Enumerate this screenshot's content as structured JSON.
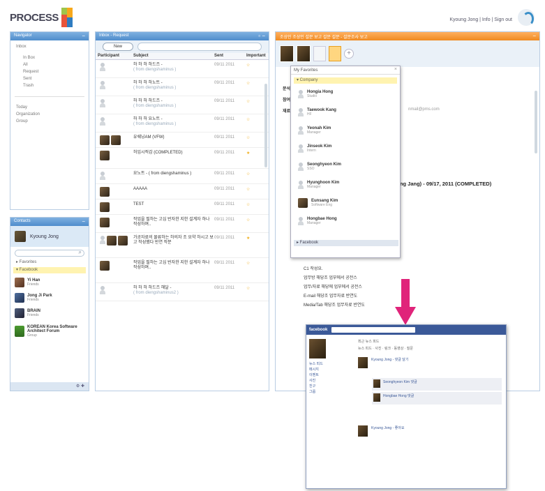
{
  "header": {
    "logo_text": "PROCESS",
    "user_links": "Kyoung Jong | Info | Sign out"
  },
  "nav": {
    "title": "Navigator",
    "top_item": "Inbox",
    "sub_items": [
      "In Box",
      "All",
      "Request",
      "Sent",
      "Trash"
    ],
    "sections": [
      "Today",
      "Organization",
      "Group"
    ]
  },
  "contacts": {
    "title": "Contacts",
    "me_name": "Kyoung Jong",
    "groups": {
      "favorites": "▸ Favorites",
      "facebook": "▾ Facebook"
    },
    "people": [
      {
        "name": "Yi Han",
        "sub": "Friends"
      },
      {
        "name": "Jong Ji Park",
        "sub": "Friends"
      },
      {
        "name": "BRAIN",
        "sub": "Friends"
      },
      {
        "name": "KOREAN Korea Software Architect Forum",
        "sub": "Group"
      }
    ]
  },
  "list": {
    "title": "Inbox - Request",
    "new_button": "New",
    "columns": [
      "Participant",
      "Subject",
      "Sent",
      "Important"
    ],
    "rows": [
      {
        "subject": "하 하 하 하드즈 -",
        "sub": "( from diengshaminus )",
        "sent": "09/11 2011",
        "star": "☆"
      },
      {
        "subject": "하 하 하 하노트 -",
        "sub": "( from diengshaminus )",
        "sent": "09/11 2011",
        "star": "☆"
      },
      {
        "subject": "하 하 하 하드즈 -",
        "sub": "( from diengshaminus )",
        "sent": "09/11 2011",
        "star": "☆"
      },
      {
        "subject": "하 하 하 요노트 -",
        "sub": "( from diengshaminus )",
        "sent": "09/11 2011",
        "star": "☆"
      },
      {
        "subject": "유쉐닝AM (VFW)",
        "sub": "",
        "sent": "09/11 2011",
        "star": "☆"
      },
      {
        "subject": "허임시적감 (COMPLETED)",
        "sub": "",
        "sent": "09/11 2011",
        "star": "★"
      },
      {
        "subject": "요노트 -  ( from diengshaminus )",
        "sub": "",
        "sent": "09/11 2011",
        "star": "☆"
      },
      {
        "subject": "AAAAA",
        "sub": "",
        "sent": "09/11 2011",
        "star": "☆"
      },
      {
        "subject": "TEST",
        "sub": "",
        "sent": "09/11 2011",
        "star": "☆"
      },
      {
        "subject": "작업을 필하는 고심 반자한 지한 설계자 하나 작성하며..",
        "sub": "",
        "sent": "09/11 2011",
        "star": "☆"
      },
      {
        "subject": "가공자료의 물류하는 하의자 조 요약 하시고 보고 작성했다 반연 작분",
        "sub": "",
        "sent": "09/11 2011",
        "star": "★"
      },
      {
        "subject": "작업을 필하는 고심 반자한 지한 설계자 하나 작성하며..",
        "sub": "",
        "sent": "09/11 2011",
        "star": "☆"
      },
      {
        "subject": "하 하 하 하드즈 해달 -",
        "sub": "( from diengshaminus2 )",
        "sent": "09/11 2011",
        "star": "☆"
      }
    ]
  },
  "detail": {
    "header": "조상인 조상인 설문 보고 설문 설문 - 설문조사 보고",
    "lines": [
      "분석",
      "참여",
      "재료"
    ],
    "email_fragment": "nmail@pms.com",
    "convo_title": "nyoung Jang) - 09/17, 2011 (COMPLETED)",
    "convo_lines": [
      "C1 작성요.",
      "업무방 해당조 업부에서 공전스",
      "업무/자료 해당에 업부에서 공전스",
      "E-mail 해당조 업무자료 반연도",
      "Media/Tab 해당조 업무자료 반연도"
    ]
  },
  "favorites_popup": {
    "title": "My Favorites",
    "group": "▾ Company",
    "people": [
      {
        "name": "Hongia Hong",
        "sub": "Studio"
      },
      {
        "name": "Taewook Kang",
        "sub": "HF"
      },
      {
        "name": "Yeonah Kim",
        "sub": "Manager"
      },
      {
        "name": "Jinseok Kim",
        "sub": "Intern"
      },
      {
        "name": "Seonghyeon Kim",
        "sub": "SSO"
      },
      {
        "name": "Hyunghoon Kim",
        "sub": "Manager"
      },
      {
        "name": "Eunsang Kim",
        "sub": "Software Eng"
      },
      {
        "name": "Hongbae Hong",
        "sub": "Manager"
      }
    ],
    "facebook_group": "▸ Facebook"
  },
  "facebook": {
    "logo": "facebook",
    "main_lines": [
      "최근 뉴스 피드",
      "뉴스 피드 · 사진 · 링크 · 동영상 · 질문"
    ],
    "side_items": [
      "뉴스 피드",
      "메시지",
      "이벤트",
      "사진",
      "친구",
      "그룹"
    ],
    "posts": [
      {
        "name": "Kyoung Jong - 댓글 달기"
      },
      {
        "name": "Kyoung Jong - 좋아요"
      }
    ],
    "comments": [
      {
        "name": "Seonghyeon Kim 댓글"
      },
      {
        "name": "Hongbae Hong 댓글"
      }
    ]
  },
  "colors": {
    "accent_blue": "#4f8ccc",
    "accent_orange": "#f08a20",
    "arrow_pink": "#e0247a",
    "facebook_blue": "#3b5998"
  }
}
